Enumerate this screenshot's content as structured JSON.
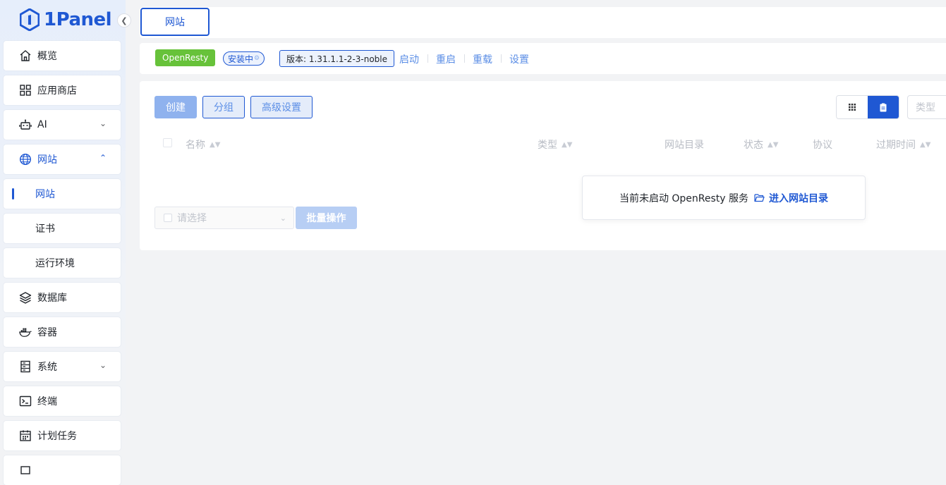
{
  "brand": {
    "name": "1Panel",
    "color": "#1f58d3"
  },
  "sidebar": {
    "items": [
      {
        "label": "概览",
        "icon": "home-icon"
      },
      {
        "label": "应用商店",
        "icon": "grid-icon"
      },
      {
        "label": "AI",
        "icon": "robot-icon"
      },
      {
        "label": "网站",
        "icon": "globe-icon"
      },
      {
        "label": "网站"
      },
      {
        "label": "证书"
      },
      {
        "label": "运行环境"
      },
      {
        "label": "数据库",
        "icon": "layers-icon"
      },
      {
        "label": "容器",
        "icon": "docker-icon"
      },
      {
        "label": "系统",
        "icon": "server-icon"
      },
      {
        "label": "终端",
        "icon": "terminal-icon"
      },
      {
        "label": "计划任务",
        "icon": "calendar-icon"
      }
    ]
  },
  "tabs": [
    {
      "label": "网站",
      "active": true
    }
  ],
  "status": {
    "app": "OpenResty",
    "state": "安装中",
    "version": "版本: 1.31.1.1-2-3-noble",
    "actions": [
      "启动",
      "重启",
      "重载",
      "设置"
    ]
  },
  "toolbar": {
    "create": "创建",
    "group": "分组",
    "advanced": "高级设置",
    "type_placeholder": "类型"
  },
  "table": {
    "columns": [
      "名称",
      "类型",
      "网站目录",
      "状态",
      "协议",
      "过期时间"
    ]
  },
  "popover": {
    "message": "当前未启动 OpenResty 服务",
    "link": "进入网站目录"
  },
  "batch": {
    "placeholder": "请选择",
    "button": "批量操作"
  }
}
